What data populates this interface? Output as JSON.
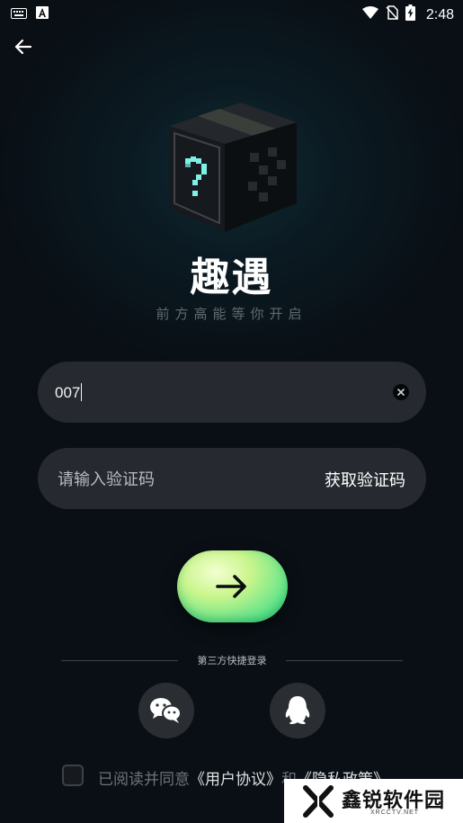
{
  "status_bar": {
    "time": "2:48",
    "icons": [
      "keyboard-icon",
      "a-badge-icon",
      "wifi-icon",
      "no-sim-icon",
      "battery-charging-icon"
    ]
  },
  "app": {
    "title": "趣遇",
    "slogan": "前方高能等你开启"
  },
  "phone": {
    "value": "007"
  },
  "verification": {
    "placeholder": "请输入验证码",
    "get_code_label": "获取验证码"
  },
  "third_party": {
    "label": "第三方快捷登录",
    "buttons": [
      "wechat-icon",
      "qq-icon"
    ]
  },
  "agreement": {
    "prefix": "已阅读并同意",
    "user_agreement": "《用户协议》",
    "conjunction": "和",
    "privacy_policy": "《隐私政策》"
  },
  "watermark": {
    "text": "鑫锐软件园",
    "sub": "XRCCTV.NET"
  },
  "colors": {
    "background": "#0b1a22",
    "field": "#262a30",
    "accent_green": "#5fe48a",
    "cube_cyan": "#7ff0e6"
  }
}
